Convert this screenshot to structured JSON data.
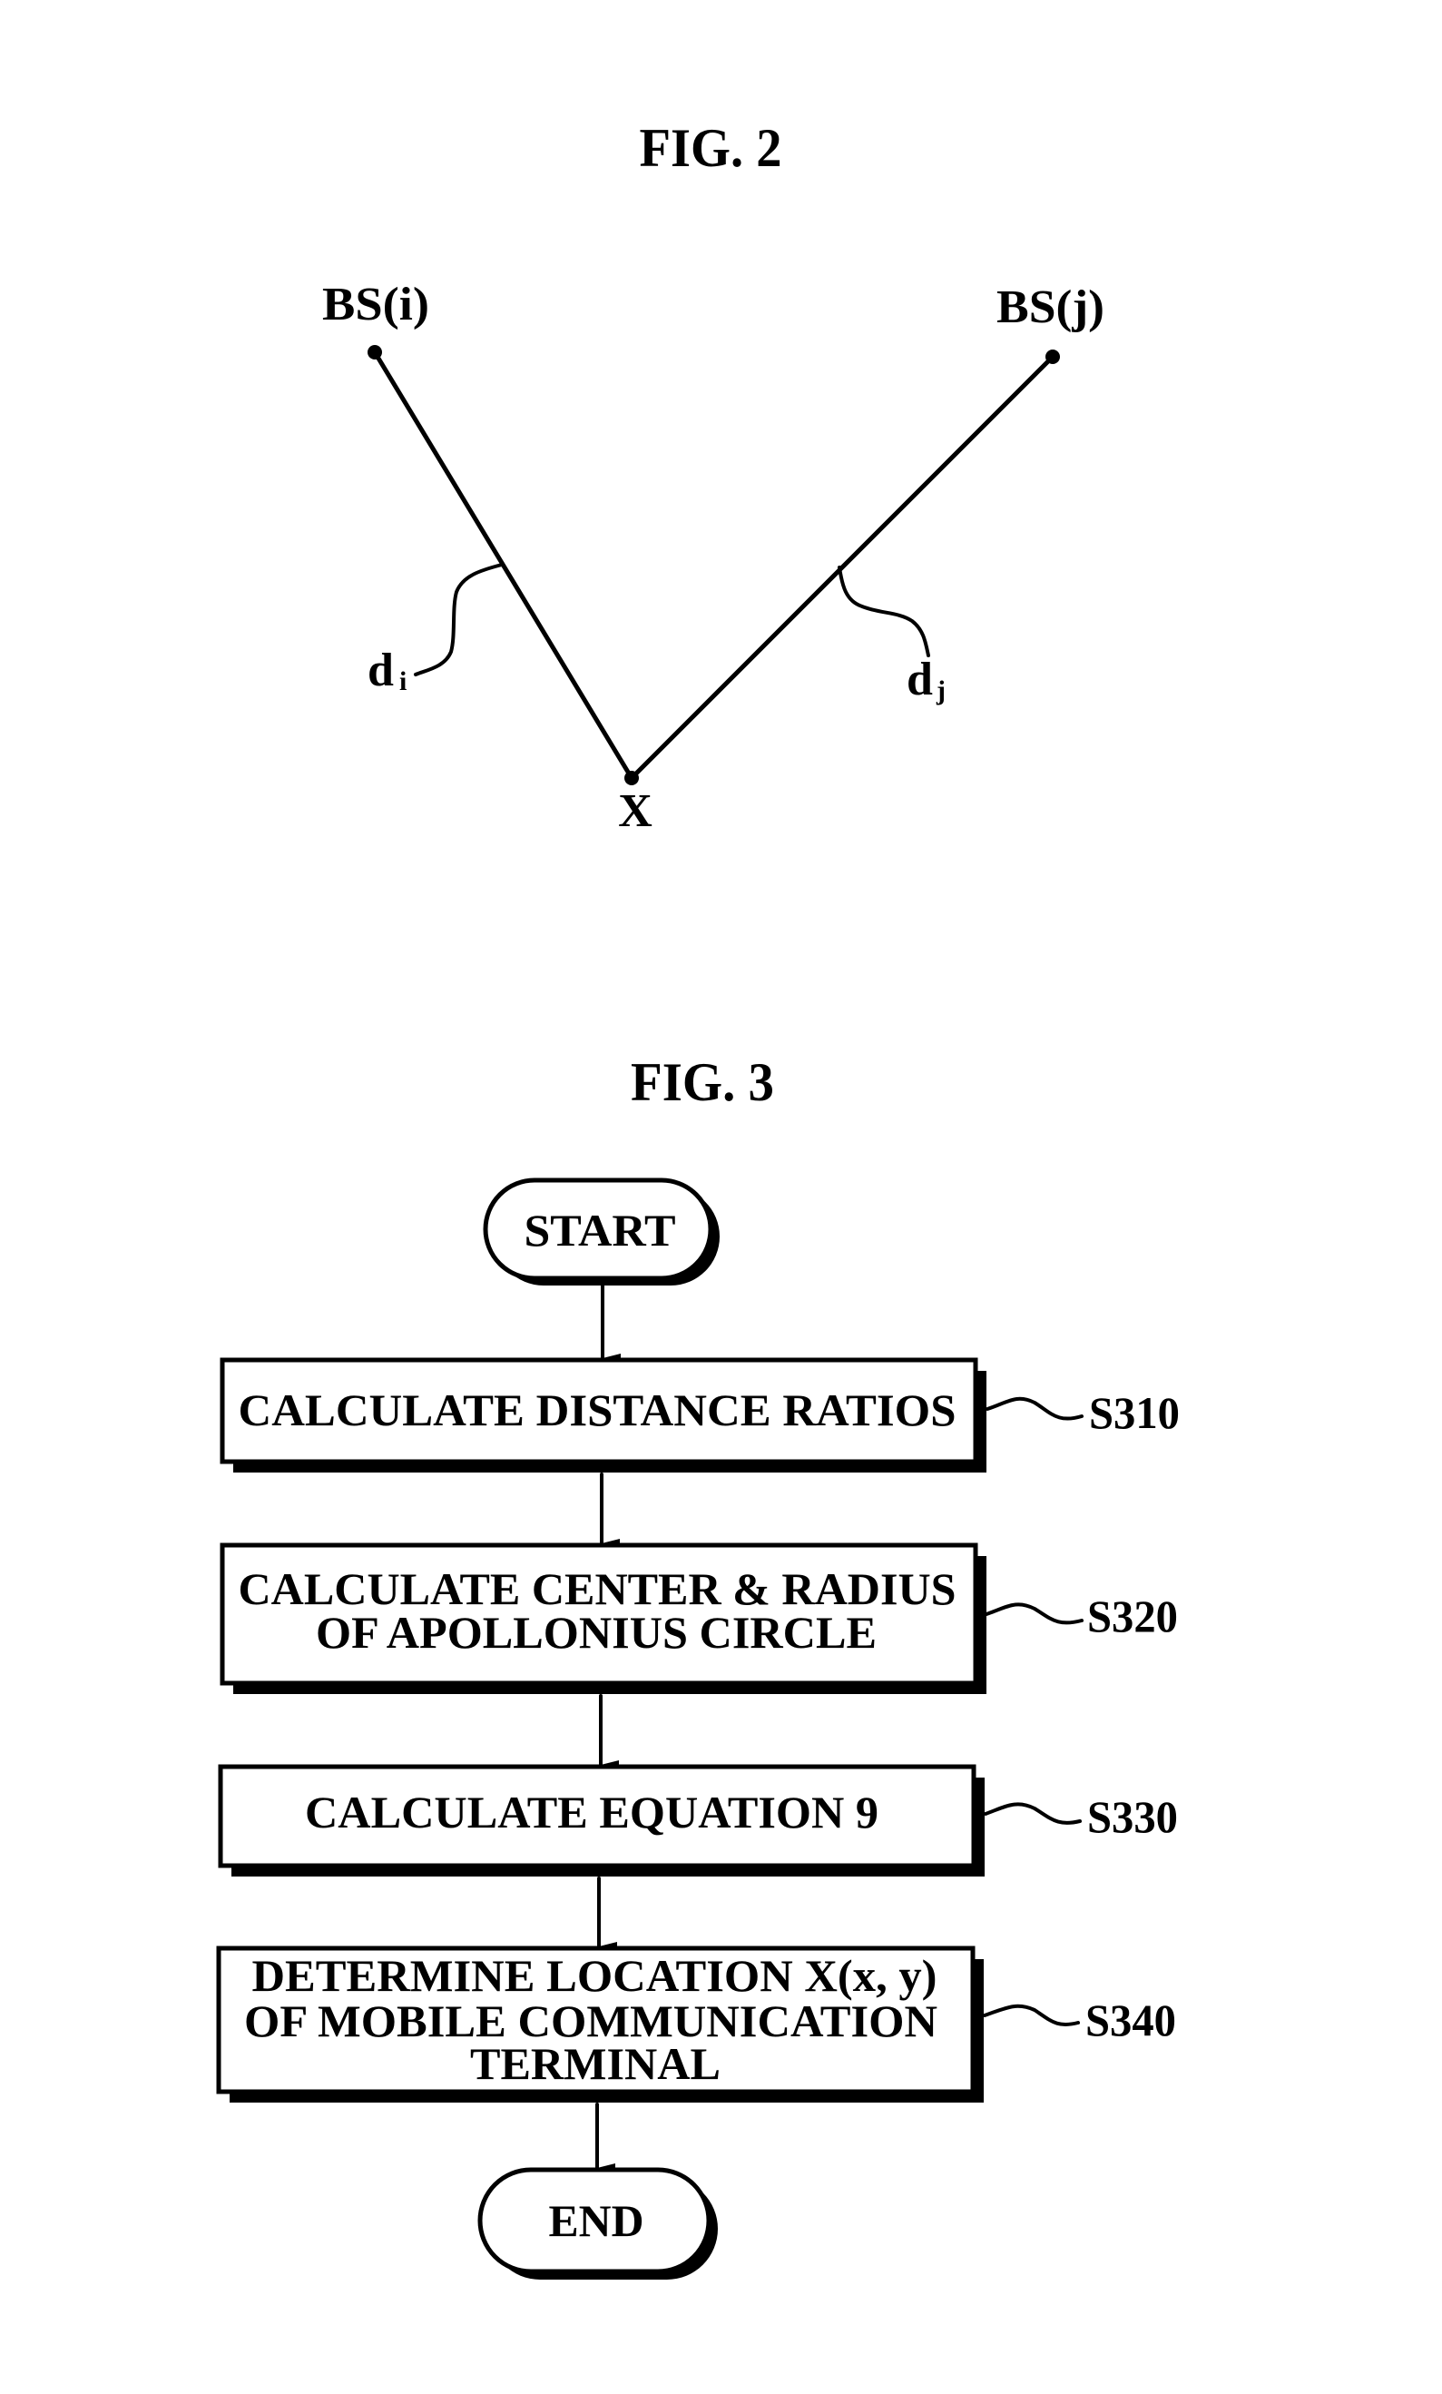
{
  "figure2": {
    "title": "FIG. 2",
    "nodes": {
      "bs_i": "BS(i)",
      "bs_j": "BS(j)",
      "terminal": "X"
    },
    "distances": {
      "d_i": {
        "base": "d",
        "subscript": "i"
      },
      "d_j": {
        "base": "d",
        "subscript": "j"
      }
    }
  },
  "figure3": {
    "title": "FIG. 3",
    "start": "START",
    "end": "END",
    "steps": [
      {
        "id": "S310",
        "lines": [
          "CALCULATE DISTANCE RATIOS"
        ]
      },
      {
        "id": "S320",
        "lines": [
          "CALCULATE CENTER & RADIUS",
          "OF APOLLONIUS CIRCLE"
        ]
      },
      {
        "id": "S330",
        "lines": [
          "CALCULATE EQUATION 9"
        ]
      },
      {
        "id": "S340",
        "lines": [
          "DETERMINE LOCATION X(x, y)",
          "OF MOBILE COMMUNICATION",
          "TERMINAL"
        ]
      }
    ]
  }
}
